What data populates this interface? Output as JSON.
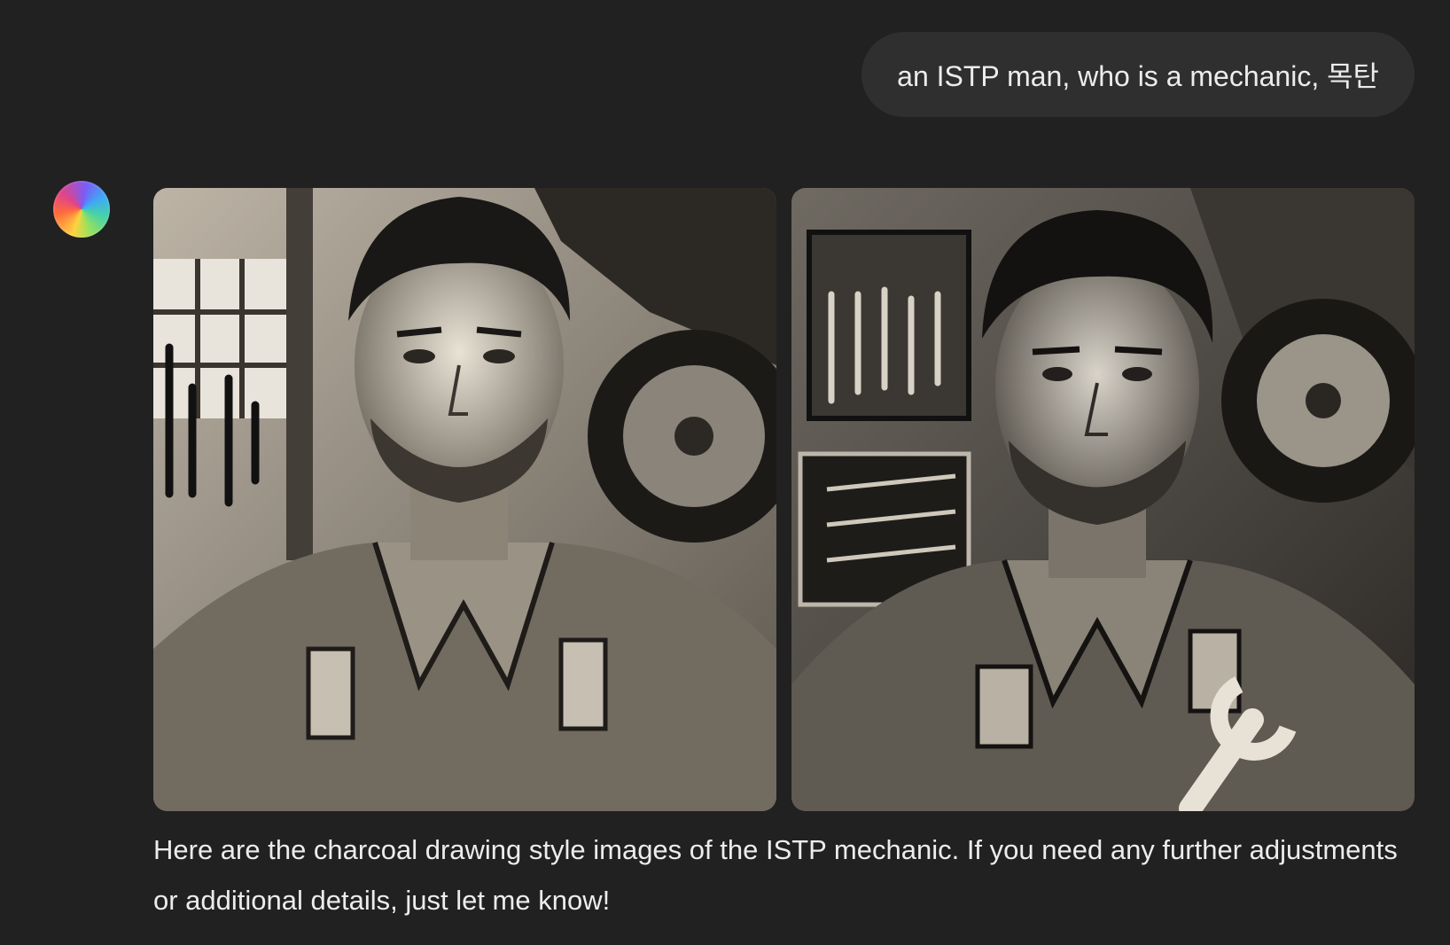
{
  "user_message": {
    "text": "an ISTP man, who is a mechanic, 목탄"
  },
  "assistant_message": {
    "avatar": "chatgpt-logo-icon",
    "images": [
      {
        "subject": "charcoal drawing of mechanic with wrenches on wall and car tire"
      },
      {
        "subject": "charcoal drawing of mechanic with tool board, tool chest and holding a wrench"
      }
    ],
    "text": "Here are the charcoal drawing style images of the ISTP mechanic. If you need any further adjustments or additional details, just let me know!"
  },
  "colors": {
    "background": "#212121",
    "bubble": "#2f2f2f",
    "text": "#ececec"
  }
}
